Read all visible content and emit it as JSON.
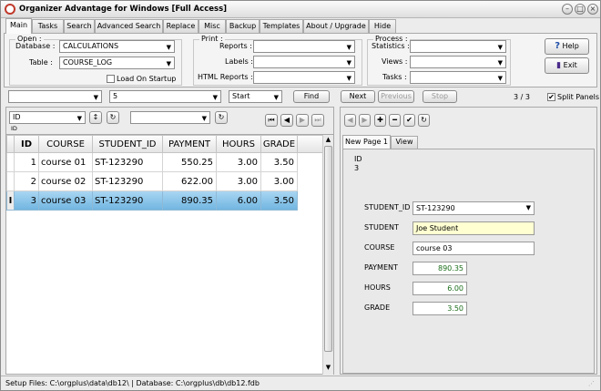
{
  "window": {
    "title": "Organizer Advantage for Windows [Full Access]",
    "minimize": "–",
    "maximize": "□",
    "close": "×"
  },
  "tabs": [
    "Main",
    "Tasks",
    "Search",
    "Advanced Search",
    "Replace",
    "Misc",
    "Backup",
    "Templates",
    "About / Upgrade",
    "Hide"
  ],
  "open_group": {
    "legend": "Open :",
    "database_label": "Database :",
    "database_value": "CALCULATIONS",
    "table_label": "Table :",
    "table_value": "COURSE_LOG",
    "load_on_startup": "Load On Startup"
  },
  "print_group": {
    "legend": "Print :",
    "reports": "Reports :",
    "labels": "Labels :",
    "html_reports": "HTML Reports :"
  },
  "process_group": {
    "legend": "Process :",
    "statistics": "Statistics :",
    "views": "Views :",
    "tasks": "Tasks :"
  },
  "buttons": {
    "help": "Help",
    "exit": "Exit"
  },
  "search_bar": {
    "field_value": "",
    "search_value": "5",
    "start_value": "Start",
    "find": "Find",
    "next": "Next",
    "previous": "Previous",
    "stop": "Stop",
    "record_count": "3 / 3",
    "split_panels": "Split Panels"
  },
  "left_toolbar": {
    "sort_field": "ID",
    "sort_field_small": "ID"
  },
  "grid": {
    "columns": [
      "ID",
      "COURSE",
      "STUDENT_ID",
      "PAYMENT",
      "HOURS",
      "GRADE"
    ],
    "rows": [
      {
        "id": "1",
        "course": "course 01",
        "student_id": "ST-123290",
        "payment": "550.25",
        "hours": "3.00",
        "grade": "3.50"
      },
      {
        "id": "2",
        "course": "course 02",
        "student_id": "ST-123290",
        "payment": "622.00",
        "hours": "3.00",
        "grade": "3.00"
      },
      {
        "id": "3",
        "course": "course 03",
        "student_id": "ST-123290",
        "payment": "890.35",
        "hours": "6.00",
        "grade": "3.50"
      }
    ],
    "current_marker": "I"
  },
  "form": {
    "tabs": [
      "New Page 1",
      "View"
    ],
    "id_label": "ID",
    "id_value": "3",
    "fields": [
      {
        "label": "STUDENT_ID",
        "value": "ST-123290"
      },
      {
        "label": "STUDENT",
        "value": "Joe Student"
      },
      {
        "label": "COURSE",
        "value": "course 03"
      },
      {
        "label": "PAYMENT",
        "value": "890.35"
      },
      {
        "label": "HOURS",
        "value": "6.00"
      },
      {
        "label": "GRADE",
        "value": "3.50"
      }
    ]
  },
  "status_bar": "Setup Files: C:\\orgplus\\data\\db12\\ | Database: C:\\orgplus\\db\\db12.fdb",
  "colors": {
    "selected_row": "#7fbfe6",
    "student_highlight": "#ffffd2"
  }
}
